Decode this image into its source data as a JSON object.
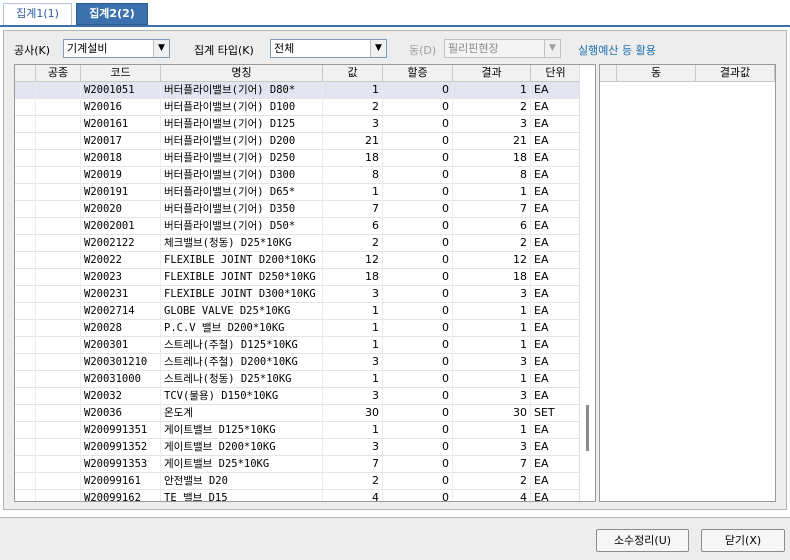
{
  "tabs": [
    {
      "label": "집계1(1)"
    },
    {
      "label": "집계2(2)"
    }
  ],
  "filters": {
    "construction_label": "공사(K)",
    "construction_value": "기계설비",
    "type_label": "집계 타입(K)",
    "type_value": "전체",
    "dong_label": "동(D)",
    "dong_value": "필리핀현장",
    "link_text": "실행예산 등 활용"
  },
  "grid": {
    "headers": [
      "공종",
      "코드",
      "명칭",
      "값",
      "할증",
      "결과",
      "단위"
    ],
    "rows": [
      {
        "code": "W2001051",
        "name": "버터플라이밸브(기어)  D80*",
        "value": "1",
        "extra": "0",
        "result": "1",
        "unit": "EA"
      },
      {
        "code": "W20016",
        "name": "버터플라이밸브(기어)  D100",
        "value": "2",
        "extra": "0",
        "result": "2",
        "unit": "EA"
      },
      {
        "code": "W200161",
        "name": "버터플라이밸브(기어)  D125",
        "value": "3",
        "extra": "0",
        "result": "3",
        "unit": "EA"
      },
      {
        "code": "W20017",
        "name": "버터플라이밸브(기어)  D200",
        "value": "21",
        "extra": "0",
        "result": "21",
        "unit": "EA"
      },
      {
        "code": "W20018",
        "name": "버터플라이밸브(기어)  D250",
        "value": "18",
        "extra": "0",
        "result": "18",
        "unit": "EA"
      },
      {
        "code": "W20019",
        "name": "버터플라이밸브(기어)  D300",
        "value": "8",
        "extra": "0",
        "result": "8",
        "unit": "EA"
      },
      {
        "code": "W200191",
        "name": "버터플라이밸브(기어)  D65*",
        "value": "1",
        "extra": "0",
        "result": "1",
        "unit": "EA"
      },
      {
        "code": "W20020",
        "name": "버터플라이밸브(기어)  D350",
        "value": "7",
        "extra": "0",
        "result": "7",
        "unit": "EA"
      },
      {
        "code": "W2002001",
        "name": "버터플라이밸브(기어)  D50*",
        "value": "6",
        "extra": "0",
        "result": "6",
        "unit": "EA"
      },
      {
        "code": "W2002122",
        "name": "체크밸브(청동)  D25*10KG",
        "value": "2",
        "extra": "0",
        "result": "2",
        "unit": "EA"
      },
      {
        "code": "W20022",
        "name": "FLEXIBLE JOINT  D200*10KG",
        "value": "12",
        "extra": "0",
        "result": "12",
        "unit": "EA"
      },
      {
        "code": "W20023",
        "name": "FLEXIBLE JOINT  D250*10KG",
        "value": "18",
        "extra": "0",
        "result": "18",
        "unit": "EA"
      },
      {
        "code": "W200231",
        "name": "FLEXIBLE JOINT  D300*10KG",
        "value": "3",
        "extra": "0",
        "result": "3",
        "unit": "EA"
      },
      {
        "code": "W2002714",
        "name": "GLOBE VALVE  D25*10KG",
        "value": "1",
        "extra": "0",
        "result": "1",
        "unit": "EA"
      },
      {
        "code": "W20028",
        "name": "P.C.V 밸브  D200*10KG",
        "value": "1",
        "extra": "0",
        "result": "1",
        "unit": "EA"
      },
      {
        "code": "W200301",
        "name": "스트레나(주철)  D125*10KG",
        "value": "1",
        "extra": "0",
        "result": "1",
        "unit": "EA"
      },
      {
        "code": "W200301210",
        "name": "스트레나(주철)  D200*10KG",
        "value": "3",
        "extra": "0",
        "result": "3",
        "unit": "EA"
      },
      {
        "code": "W20031000",
        "name": "스트레나(청동)  D25*10KG",
        "value": "1",
        "extra": "0",
        "result": "1",
        "unit": "EA"
      },
      {
        "code": "W20032",
        "name": "TCV(물용)  D150*10KG",
        "value": "3",
        "extra": "0",
        "result": "3",
        "unit": "EA"
      },
      {
        "code": "W20036",
        "name": "온도계",
        "value": "30",
        "extra": "0",
        "result": "30",
        "unit": "SET"
      },
      {
        "code": "W200991351",
        "name": "게이트밸브  D125*10KG",
        "value": "1",
        "extra": "0",
        "result": "1",
        "unit": "EA"
      },
      {
        "code": "W200991352",
        "name": "게이트밸브  D200*10KG",
        "value": "3",
        "extra": "0",
        "result": "3",
        "unit": "EA"
      },
      {
        "code": "W200991353",
        "name": "게이트밸브  D25*10KG",
        "value": "7",
        "extra": "0",
        "result": "7",
        "unit": "EA"
      },
      {
        "code": "W20099161",
        "name": "안전밸브  D20",
        "value": "2",
        "extra": "0",
        "result": "2",
        "unit": "EA"
      },
      {
        "code": "W20099162",
        "name": "TE 밸브  D15",
        "value": "4",
        "extra": "0",
        "result": "4",
        "unit": "EA"
      }
    ]
  },
  "right_grid": {
    "headers": [
      "동",
      "결과값"
    ]
  },
  "buttons": {
    "round_label": "소수정리(U)",
    "close_label": "닫기(X)"
  }
}
